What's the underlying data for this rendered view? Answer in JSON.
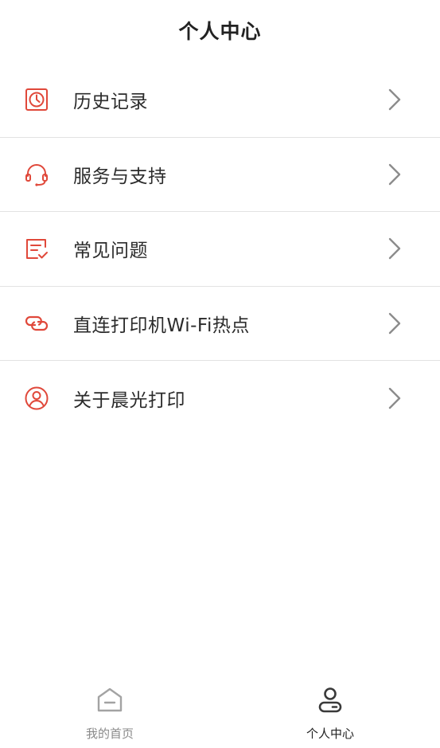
{
  "header": {
    "title": "个人中心"
  },
  "colors": {
    "accent": "#e0483a",
    "chevron": "#8c8c8c",
    "tab_active": "#333333",
    "tab_inactive": "#9a9a9a"
  },
  "menu": {
    "items": [
      {
        "label": "历史记录",
        "icon": "clock-icon"
      },
      {
        "label": "服务与支持",
        "icon": "headset-icon"
      },
      {
        "label": "常见问题",
        "icon": "checklist-icon"
      },
      {
        "label": "直连打印机Wi-Fi热点",
        "icon": "link-icon"
      },
      {
        "label": "关于晨光打印",
        "icon": "user-circle-icon"
      }
    ]
  },
  "tabbar": {
    "tabs": [
      {
        "label": "我的首页",
        "icon": "home-icon",
        "active": false
      },
      {
        "label": "个人中心",
        "icon": "person-icon",
        "active": true
      }
    ]
  }
}
